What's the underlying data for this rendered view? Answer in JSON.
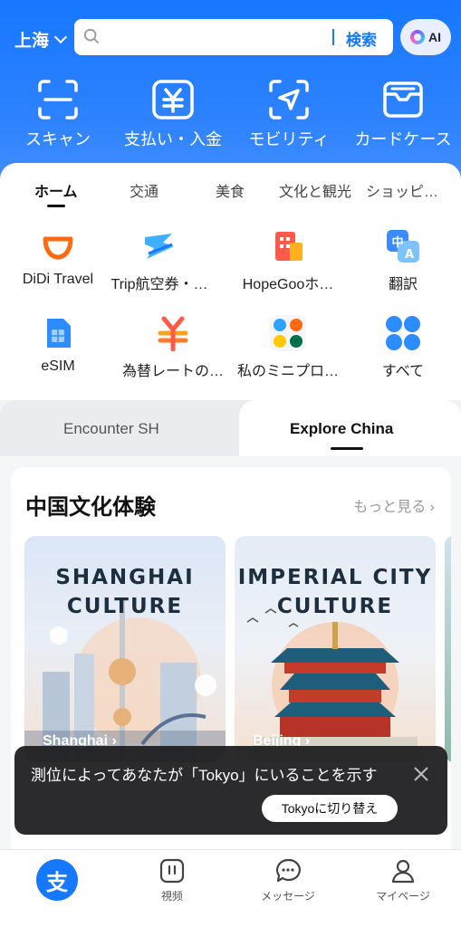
{
  "header": {
    "city": "上海",
    "search_placeholder": "",
    "search_button": "検索",
    "ai_label": "AI"
  },
  "quick_actions": [
    {
      "label": "スキャン",
      "icon": "scan-icon"
    },
    {
      "label": "支払い・入金",
      "icon": "yen-payment-icon"
    },
    {
      "label": "モビリティ",
      "icon": "navigation-arrow-icon"
    },
    {
      "label": "カードケース",
      "icon": "card-wallet-icon"
    }
  ],
  "tabs": [
    "ホーム",
    "交通",
    "美食",
    "文化と観光",
    "ショッピ…"
  ],
  "services": [
    {
      "label": "DiDi Travel",
      "icon": "didi-icon"
    },
    {
      "label": "Trip航空券・…",
      "icon": "trip-flight-icon"
    },
    {
      "label": "HopeGooホ…",
      "icon": "hopegoo-hotel-icon"
    },
    {
      "label": "翻訳",
      "icon": "translate-icon"
    },
    {
      "label": "eSIM",
      "icon": "esim-icon"
    },
    {
      "label": "為替レートの…",
      "icon": "exchange-rate-icon"
    },
    {
      "label": "私のミニプロ…",
      "icon": "mini-programs-icon"
    },
    {
      "label": "すべて",
      "icon": "all-services-icon"
    }
  ],
  "segment": {
    "left": "Encounter SH",
    "right": "Explore China"
  },
  "culture": {
    "title": "中国文化体験",
    "more": "もっと見る",
    "posters": [
      {
        "line1": "SHANGHAI",
        "line2": "CULTURE",
        "city": "Shanghai"
      },
      {
        "line1": "IMPERIAL CITY",
        "line2": "CULTURE",
        "city": "Beijing"
      }
    ]
  },
  "toast": {
    "message": "測位によってあなたが「Tokyo」にいることを示す",
    "button": "Tokyoに切り替え"
  },
  "bottom_nav": [
    {
      "label": "",
      "icon": "alipay-home-icon"
    },
    {
      "label": "視频",
      "icon": "video-icon"
    },
    {
      "label": "メッセージ",
      "icon": "message-icon"
    },
    {
      "label": "マイページ",
      "icon": "profile-icon"
    }
  ],
  "colors": {
    "brand": "#1677ff"
  }
}
